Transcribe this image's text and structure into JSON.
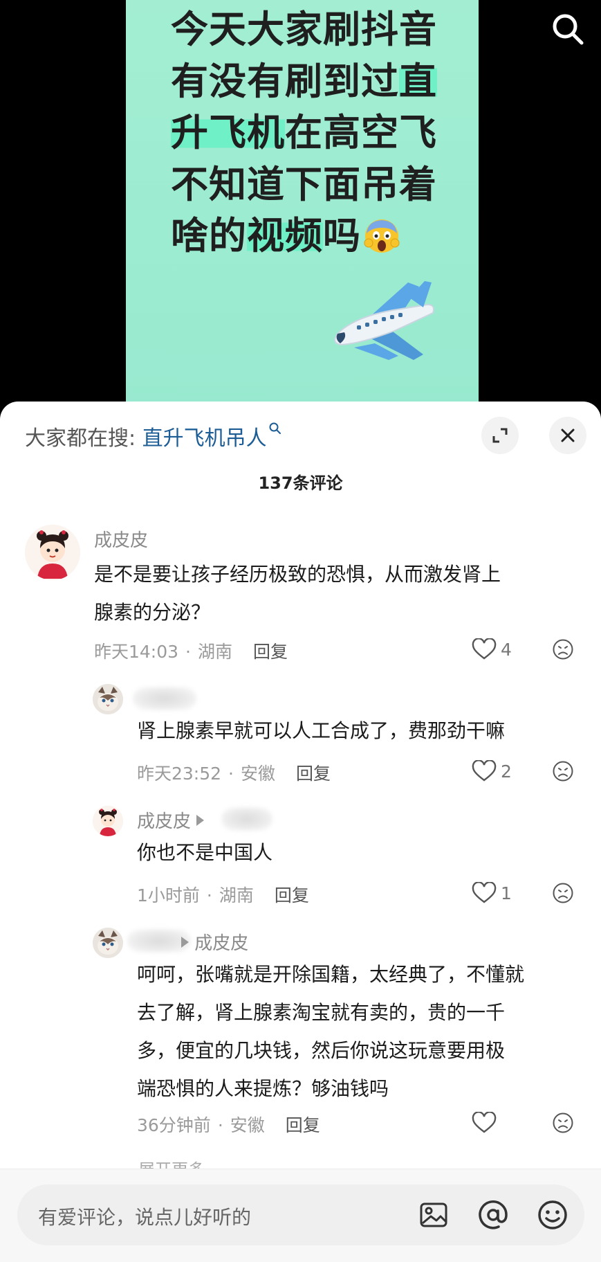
{
  "video": {
    "lines": [
      {
        "a": "今天大家刷抖音",
        "h": "",
        "b": ""
      },
      {
        "a": "有没有刷到过",
        "h": "直",
        "b": ""
      },
      {
        "a": "",
        "h": "升飞机",
        "b": "在高空飞"
      },
      {
        "a": "不知道下面吊着",
        "h": "",
        "b": ""
      },
      {
        "a": "啥的",
        "h": "视频",
        "b": "吗"
      }
    ]
  },
  "sheet": {
    "suggest_prefix": "大家都在搜: ",
    "suggest_term": "直升飞机吊人",
    "comment_count": "137条评论"
  },
  "comments": [
    {
      "name": "成皮皮",
      "lines": [
        "是不是要让孩子经历极致的恐惧，从而激发肾上",
        "腺素的分泌？"
      ],
      "time": "昨天14:03",
      "location": "湖南",
      "reply": "回复",
      "likes": "4"
    },
    {
      "lines": [
        "肾上腺素早就可以人工合成了，费那劲干嘛"
      ],
      "time": "昨天23:52",
      "location": "安徽",
      "reply": "回复",
      "likes": "2"
    },
    {
      "name": "成皮皮",
      "lines": [
        "你也不是中国人"
      ],
      "time": "1小时前",
      "location": "湖南",
      "reply": "回复",
      "likes": "1"
    },
    {
      "reply_to": "成皮皮",
      "lines": [
        "呵呵，张嘴就是开除国籍，太经典了，不懂就",
        "去了解，肾上腺素淘宝就有卖的，贵的一千",
        "多，便宜的几块钱，然后你说这玩意要用极",
        "端恐惧的人来提炼？够油钱吗"
      ],
      "time": "36分钟前",
      "location": "安徽",
      "reply": "回复",
      "likes": ""
    }
  ],
  "more_peek": "展开更多",
  "input": {
    "placeholder": "有爱评论，说点儿好听的"
  },
  "colors": {
    "video_bg": "#a3eed3",
    "highlight": "#6ff0c7",
    "link": "#1d5d96"
  },
  "icons": [
    "search-icon",
    "expand-icon",
    "close-icon",
    "heart-icon",
    "dislike-icon",
    "image-icon",
    "at-icon",
    "emoji-icon",
    "plane-emoji",
    "scream-emoji"
  ]
}
